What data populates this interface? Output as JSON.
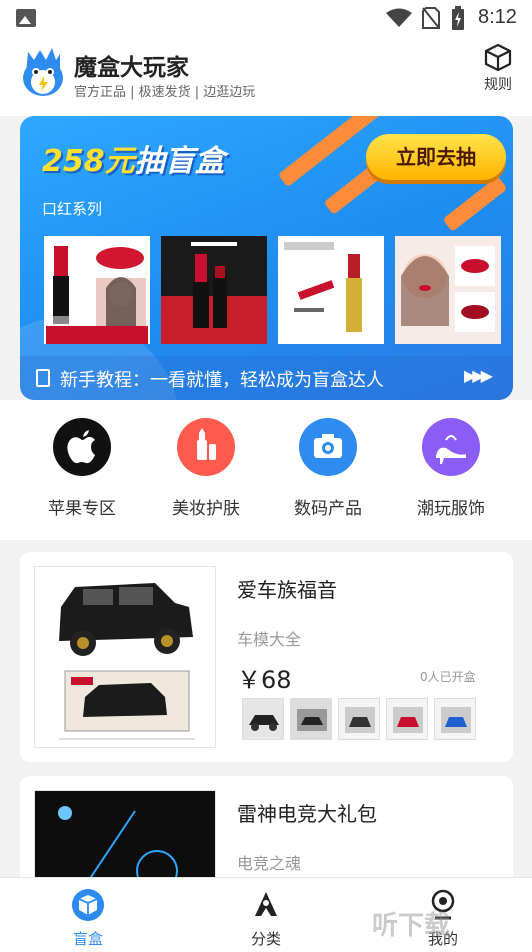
{
  "status_bar": {
    "time": "8:12"
  },
  "header": {
    "title": "魔盒大玩家",
    "subtitle": "官方正品 | 极速发货 | 边逛边玩",
    "rules_label": "规则"
  },
  "banner": {
    "title_price": "258元",
    "title_rest": "抽盲盒",
    "cta": "立即去抽",
    "series": "口红系列",
    "tutorial": "新手教程：一看就懂，轻松成为盲盒达人",
    "accent": "#ffe033",
    "background": "#1f8cf0"
  },
  "categories": [
    {
      "label": "苹果专区",
      "icon": "apple-icon",
      "color": "#111111"
    },
    {
      "label": "美妆护肤",
      "icon": "cosmetics-icon",
      "color": "#ff5a4e"
    },
    {
      "label": "数码产品",
      "icon": "camera-icon",
      "color": "#2e8cf0"
    },
    {
      "label": "潮玩服饰",
      "icon": "high-heel-icon",
      "color": "#8b5cf6"
    }
  ],
  "items": [
    {
      "name": "爱车族福音",
      "subtitle": "车模大全",
      "price": "￥68",
      "opened": "0人已开盒"
    },
    {
      "name": "雷神电竞大礼包",
      "subtitle": "电竞之魂"
    }
  ],
  "bottom_nav": [
    {
      "label": "盲盒",
      "icon": "box-icon",
      "active": true
    },
    {
      "label": "分类",
      "icon": "category-icon",
      "active": false
    },
    {
      "label": "我的",
      "icon": "profile-icon",
      "active": false
    }
  ],
  "watermark": "听下载",
  "colors": {
    "primary": "#2e8cf0",
    "text": "#222222",
    "muted": "#999999"
  }
}
